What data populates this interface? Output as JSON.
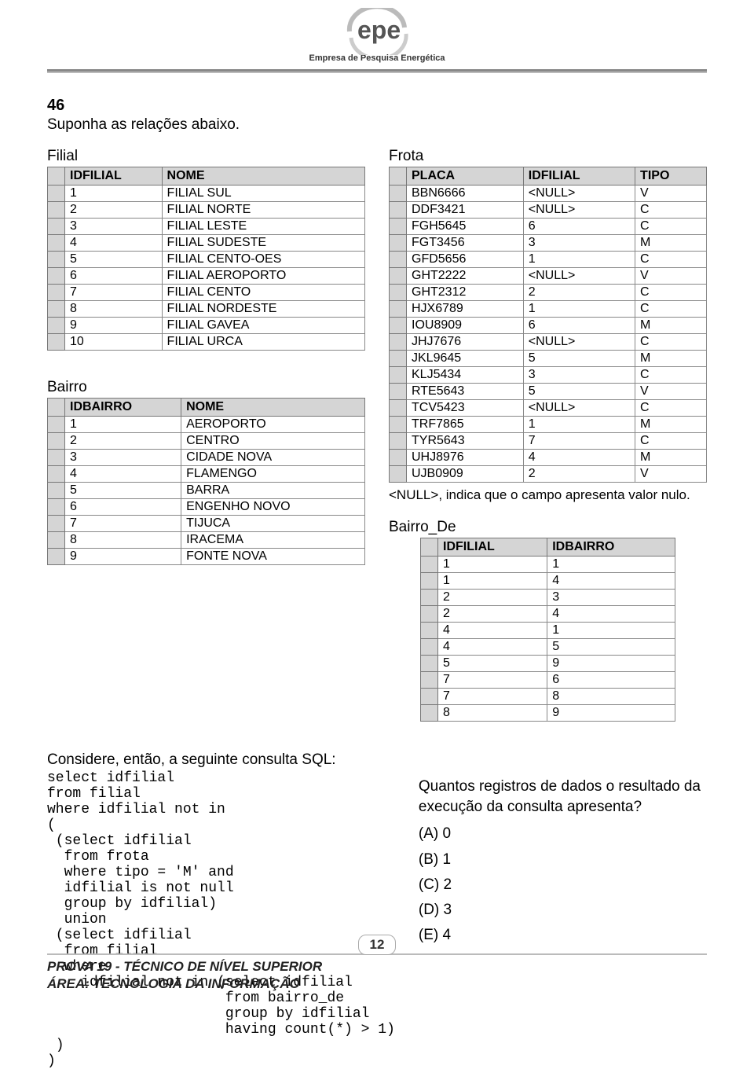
{
  "logo": {
    "text": "epe",
    "subtitle": "Empresa de Pesquisa Energética"
  },
  "question": {
    "number": "46",
    "intro": "Suponha as relações abaixo.",
    "filial_caption": "Filial",
    "bairro_caption": "Bairro",
    "frota_caption": "Frota",
    "null_note": "<NULL>, indica que o campo apresenta valor nulo.",
    "bairro_de_caption": "Bairro_De",
    "sql_intro": "Considere, então, a seguinte consulta SQL:",
    "sql": "select idfilial\nfrom filial\nwhere idfilial not in\n(\n (select idfilial\n  from frota\n  where tipo = 'M' and\n  idfilial is not null\n  group by idfilial)\n  union\n (select idfilial\n  from filial\n  where\n    idfilial not in (select idfilial\n                     from bairro_de\n                     group by idfilial\n                     having count(*) > 1)\n )\n)",
    "answer_intro": "Quantos registros de dados o resultado da execução da consulta apresenta?",
    "options": {
      "a": "(A) 0",
      "b": "(B) 1",
      "c": "(C) 2",
      "d": "(D) 3",
      "e": "(E) 4"
    }
  },
  "tables": {
    "filial": {
      "headers": [
        "IDFILIAL",
        "NOME"
      ],
      "rows": [
        [
          "1",
          "FILIAL SUL"
        ],
        [
          "2",
          "FILIAL NORTE"
        ],
        [
          "3",
          "FILIAL LESTE"
        ],
        [
          "4",
          "FILIAL SUDESTE"
        ],
        [
          "5",
          "FILIAL CENTO-OES"
        ],
        [
          "6",
          "FILIAL AEROPORTO"
        ],
        [
          "7",
          "FILIAL CENTO"
        ],
        [
          "8",
          "FILIAL NORDESTE"
        ],
        [
          "9",
          "FILIAL GAVEA"
        ],
        [
          "10",
          "FILIAL URCA"
        ]
      ]
    },
    "bairro": {
      "headers": [
        "IDBAIRRO",
        "NOME"
      ],
      "rows": [
        [
          "1",
          "AEROPORTO"
        ],
        [
          "2",
          "CENTRO"
        ],
        [
          "3",
          "CIDADE NOVA"
        ],
        [
          "4",
          "FLAMENGO"
        ],
        [
          "5",
          "BARRA"
        ],
        [
          "6",
          "ENGENHO NOVO"
        ],
        [
          "7",
          "TIJUCA"
        ],
        [
          "8",
          "IRACEMA"
        ],
        [
          "9",
          "FONTE NOVA"
        ]
      ]
    },
    "frota": {
      "headers": [
        "PLACA",
        "IDFILIAL",
        "TIPO"
      ],
      "rows": [
        [
          "BBN6666",
          "<NULL>",
          "V"
        ],
        [
          "DDF3421",
          "<NULL>",
          "C"
        ],
        [
          "FGH5645",
          "6",
          "C"
        ],
        [
          "FGT3456",
          "3",
          "M"
        ],
        [
          "GFD5656",
          "1",
          "C"
        ],
        [
          "GHT2222",
          "<NULL>",
          "V"
        ],
        [
          "GHT2312",
          "2",
          "C"
        ],
        [
          "HJX6789",
          "1",
          "C"
        ],
        [
          "IOU8909",
          "6",
          "M"
        ],
        [
          "JHJ7676",
          "<NULL>",
          "C"
        ],
        [
          "JKL9645",
          "5",
          "M"
        ],
        [
          "KLJ5434",
          "3",
          "C"
        ],
        [
          "RTE5643",
          "5",
          "V"
        ],
        [
          "TCV5423",
          "<NULL>",
          "C"
        ],
        [
          "TRF7865",
          "1",
          "M"
        ],
        [
          "TYR5643",
          "7",
          "C"
        ],
        [
          "UHJ8976",
          "4",
          "M"
        ],
        [
          "UJB0909",
          "2",
          "V"
        ]
      ]
    },
    "bairro_de": {
      "headers": [
        "IDFILIAL",
        "IDBAIRRO"
      ],
      "rows": [
        [
          "1",
          "1"
        ],
        [
          "1",
          "4"
        ],
        [
          "2",
          "3"
        ],
        [
          "2",
          "4"
        ],
        [
          "4",
          "1"
        ],
        [
          "4",
          "5"
        ],
        [
          "5",
          "9"
        ],
        [
          "7",
          "6"
        ],
        [
          "7",
          "8"
        ],
        [
          "8",
          "9"
        ]
      ]
    }
  },
  "footer": {
    "page": "12",
    "line1": "PROVA 19 - TÉCNICO DE NÍVEL SUPERIOR",
    "line2": "ÁREA: TECNOLOGIA DA INFORMAÇÃO"
  }
}
